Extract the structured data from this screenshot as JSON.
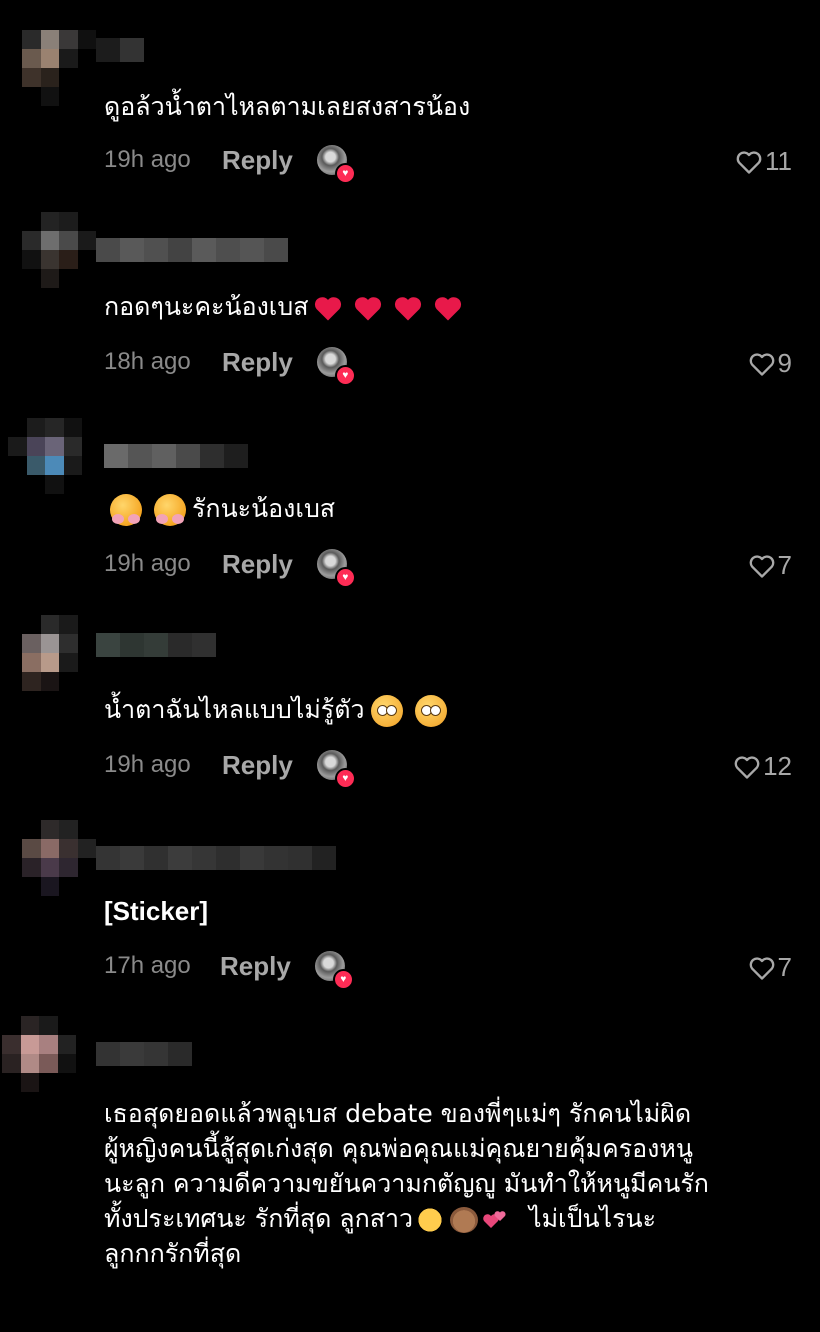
{
  "reply_label": "Reply",
  "colors": {
    "accent": "#fe2c55",
    "muted": "#8a8a8a",
    "background": "#000000"
  },
  "comments": [
    {
      "text": "ดูอล้วน้ำตาไหลตามเลยสงสารน้อง",
      "time": "19h ago",
      "likes": "11"
    },
    {
      "text": "กอดๆนะคะน้องเบส",
      "emoji": [
        "red-heart",
        "red-heart",
        "red-heart",
        "red-heart"
      ],
      "time": "18h ago",
      "likes": "9"
    },
    {
      "text": "รักนะน้องเบส",
      "emoji": [
        "smiling-face-with-hearts",
        "smiling-face-with-hearts"
      ],
      "time": "19h ago",
      "likes": "7"
    },
    {
      "text": "น้ำตาฉันไหลแบบไม่รู้ตัว",
      "emoji": [
        "flushed-face",
        "flushed-face"
      ],
      "time": "19h ago",
      "likes": "12"
    },
    {
      "text": "[Sticker]",
      "time": "17h ago",
      "likes": "7"
    },
    {
      "lines": [
        "เธอสุดยอดแล้วพลูเบส debate ของพี่ๆแม่ๆ รักคนไม่ผิด",
        "ผู้หญิงคนนี้สู้สุดเก่งสุด คุณพ่อคุณแม่คุณยายคุ้มครองหนู",
        "นะลูก ความดีความขยันความกตัญญู มันทำให้หนูมีคนรัก",
        "ทั้งประเทศนะ รักที่สุด ลูกสาว",
        "ไม่เป็นไรนะ",
        "ลูกกกรักที่สุด"
      ],
      "emoji": [
        "heart-hands",
        "bear-face",
        "two-hearts"
      ]
    }
  ]
}
